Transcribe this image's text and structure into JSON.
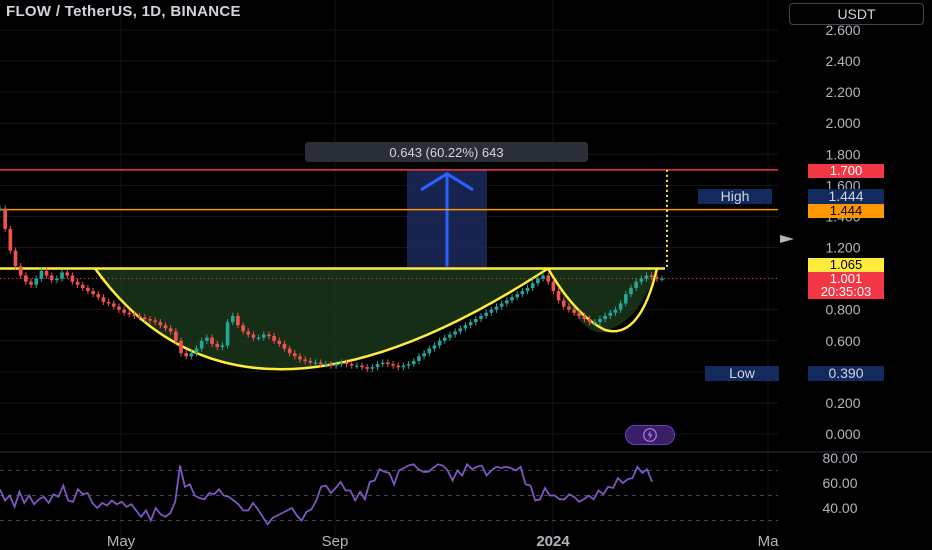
{
  "header": {
    "title": "FLOW / TetherUS, 1D, BINANCE",
    "currency_button": "USDT"
  },
  "measure": {
    "label": "0.643 (60.22%) 643"
  },
  "tags": {
    "target": "1.700",
    "high_label": "High",
    "high_value": "1.444",
    "orange_level": "1.444",
    "breakout": "1.065",
    "last_price": "1.001",
    "countdown": "20:35:03",
    "low_label": "Low",
    "low_value": "0.390"
  },
  "colors": {
    "red": "#f23645",
    "orange": "#ff9800",
    "yellow": "#ffeb3b",
    "candle_up": "#26a69a",
    "candle_down": "#ef5350",
    "cup_fill": "#1b3a1b",
    "measure_fill": "#1c2a5a",
    "arrow": "#2962ff",
    "rsi": "#7e57c2"
  },
  "chart_data": [
    {
      "type": "line",
      "title": "FLOW / TetherUS, 1D, BINANCE",
      "x_ticks": [
        "May",
        "Sep",
        "2024",
        "Ma"
      ],
      "y_ticks": [
        2.6,
        2.4,
        2.2,
        2.0,
        1.8,
        1.6,
        1.4,
        1.2,
        1.0,
        0.8,
        0.6,
        0.4,
        0.2,
        0.0
      ],
      "y_tick_labels": [
        "2.600",
        "2.400",
        "2.200",
        "2.000",
        "1.800",
        "1.600",
        "1.400",
        "1.200",
        "1.000",
        "0.800",
        "0.600",
        "0.400",
        "0.200",
        "0.000"
      ],
      "ylim": [
        0,
        2.7
      ],
      "series": [
        {
          "values": [
            1.45,
            1.32,
            1.18,
            1.08,
            1.02,
            0.98,
            0.96,
            1.0,
            1.05,
            1.02,
            0.99,
            1.0,
            1.04,
            1.02,
            0.98,
            0.96,
            0.94,
            0.92,
            0.9,
            0.88,
            0.85,
            0.84,
            0.82,
            0.8,
            0.78,
            0.77,
            0.76,
            0.75,
            0.74,
            0.73,
            0.72,
            0.7,
            0.68,
            0.66,
            0.6,
            0.52,
            0.5,
            0.52,
            0.55,
            0.6,
            0.62,
            0.58,
            0.56,
            0.57,
            0.72,
            0.76,
            0.7,
            0.66,
            0.64,
            0.62,
            0.62,
            0.64,
            0.63,
            0.6,
            0.58,
            0.55,
            0.52,
            0.5,
            0.48,
            0.47,
            0.46,
            0.46,
            0.45,
            0.45,
            0.44,
            0.45,
            0.46,
            0.45,
            0.44,
            0.44,
            0.43,
            0.42,
            0.43,
            0.45,
            0.46,
            0.45,
            0.44,
            0.43,
            0.44,
            0.45,
            0.47,
            0.5,
            0.52,
            0.55,
            0.57,
            0.6,
            0.62,
            0.64,
            0.66,
            0.68,
            0.7,
            0.72,
            0.74,
            0.76,
            0.78,
            0.8,
            0.82,
            0.84,
            0.86,
            0.88,
            0.9,
            0.92,
            0.94,
            0.97,
            1.0,
            1.02,
            0.98,
            0.92,
            0.86,
            0.82,
            0.8,
            0.78,
            0.76,
            0.74,
            0.72,
            0.72,
            0.74,
            0.76,
            0.78,
            0.8,
            0.84,
            0.9,
            0.94,
            0.98,
            1.0,
            1.02,
            1.01,
            1.0,
            1.0
          ]
        }
      ],
      "levels": {
        "target": 1.7,
        "high": 1.444,
        "breakout": 1.065,
        "last": 1.001,
        "low": 0.39
      },
      "annotations": [
        "0.643 (60.22%) 643"
      ]
    },
    {
      "type": "line",
      "title": "",
      "y_ticks": [
        80,
        60,
        40
      ],
      "y_tick_labels": [
        "80.00",
        "60.00",
        "40.00"
      ],
      "ylim": [
        28,
        90
      ],
      "series": [
        {
          "values": [
            55,
            46,
            50,
            41,
            53,
            44,
            50,
            43,
            47,
            49,
            44,
            51,
            49,
            58,
            46,
            45,
            55,
            51,
            52,
            44,
            40,
            44,
            42,
            46,
            43,
            45,
            41,
            43,
            38,
            33,
            38,
            30,
            40,
            35,
            33,
            36,
            45,
            74,
            57,
            59,
            50,
            48,
            47,
            52,
            51,
            55,
            50,
            49,
            46,
            43,
            38,
            38,
            44,
            39,
            33,
            27,
            32,
            34,
            36,
            38,
            40,
            34,
            30,
            37,
            39,
            46,
            57,
            58,
            52,
            56,
            61,
            54,
            54,
            46,
            53,
            47,
            61,
            62,
            71,
            69,
            68,
            59,
            70,
            72,
            74,
            75,
            71,
            69,
            69,
            72,
            75,
            74,
            70,
            62,
            70,
            66,
            75,
            71,
            73,
            74,
            66,
            70,
            73,
            72,
            73,
            72,
            70,
            73,
            59,
            58,
            46,
            47,
            56,
            50,
            50,
            47,
            47,
            51,
            49,
            45,
            47,
            50,
            47,
            54,
            51,
            57,
            56,
            64,
            60,
            63,
            64,
            73,
            68,
            71,
            61
          ]
        }
      ]
    }
  ]
}
